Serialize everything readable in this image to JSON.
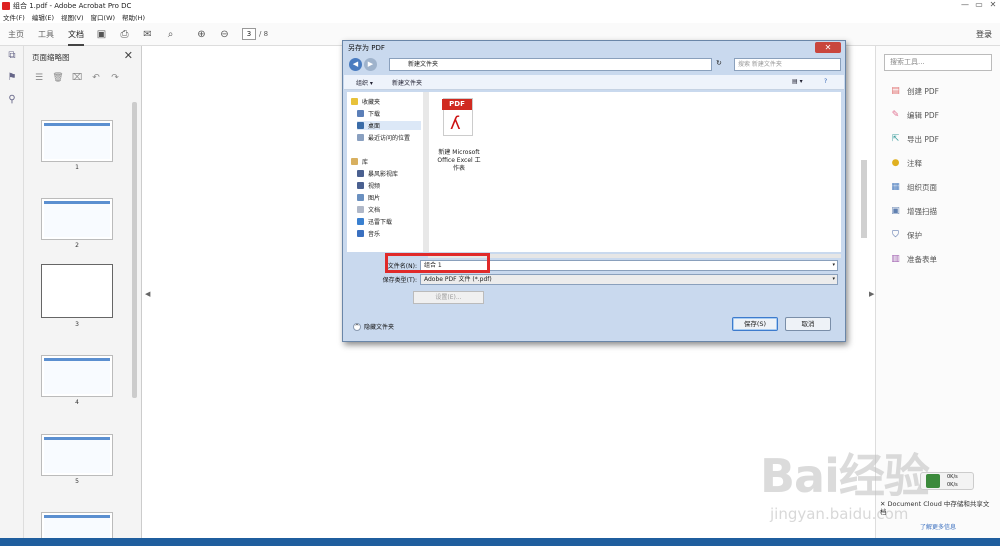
{
  "window": {
    "title": "组合 1.pdf - Adobe Acrobat Pro DC",
    "min": "—",
    "max": "▭",
    "close": "✕"
  },
  "menu": [
    "文件(F)",
    "编辑(E)",
    "视图(V)",
    "窗口(W)",
    "帮助(H)"
  ],
  "toolbar": {
    "tabs": [
      "主页",
      "工具",
      "文档"
    ],
    "page_current": "3",
    "page_total": "/ 8",
    "login": "登录"
  },
  "thumbs": {
    "title": "页面缩略图",
    "labels": [
      "1",
      "2",
      "3",
      "4",
      "5"
    ]
  },
  "dialog": {
    "title": "另存为 PDF",
    "address": "新建文件夹",
    "search_placeholder": "搜索 新建文件夹",
    "organize": "组织 ▾",
    "new_folder": "新建文件夹",
    "nav": {
      "favorites": "收藏夹",
      "download": "下载",
      "desktop": "桌面",
      "recent": "最近访问的位置",
      "libraries": "库",
      "videos_lib": "暴风影视库",
      "video": "视频",
      "pictures": "图片",
      "documents": "文档",
      "thunder": "迅雷下载",
      "music": "音乐"
    },
    "file_icon_label": "PDF",
    "file_name_display": "新建 Microsoft Office Excel 工作表",
    "filename_label": "文件名(N):",
    "filename_value": "组合 1",
    "type_label": "保存类型(T):",
    "type_value": "Adobe PDF 文件 (*.pdf)",
    "settings": "设置(E)...",
    "hide_folders": "隐藏文件夹",
    "save": "保存(S)",
    "cancel": "取消"
  },
  "right": {
    "search": "搜索工具...",
    "tools": [
      "创建 PDF",
      "编辑 PDF",
      "导出 PDF",
      "注释",
      "组织页面",
      "增强扫描",
      "保护",
      "准备表单"
    ]
  },
  "cloud": {
    "text": "Document Cloud 中存储和共享文档",
    "link": "了解更多信息",
    "speed_up": "0K/s",
    "speed_down": "0K/s"
  },
  "watermark": {
    "logo": "Bai经验",
    "url": "jingyan.baidu.com"
  },
  "colors": {
    "accent": "#3d7bcd",
    "highlight": "#e02a2a",
    "pdf_red": "#d02a20"
  }
}
